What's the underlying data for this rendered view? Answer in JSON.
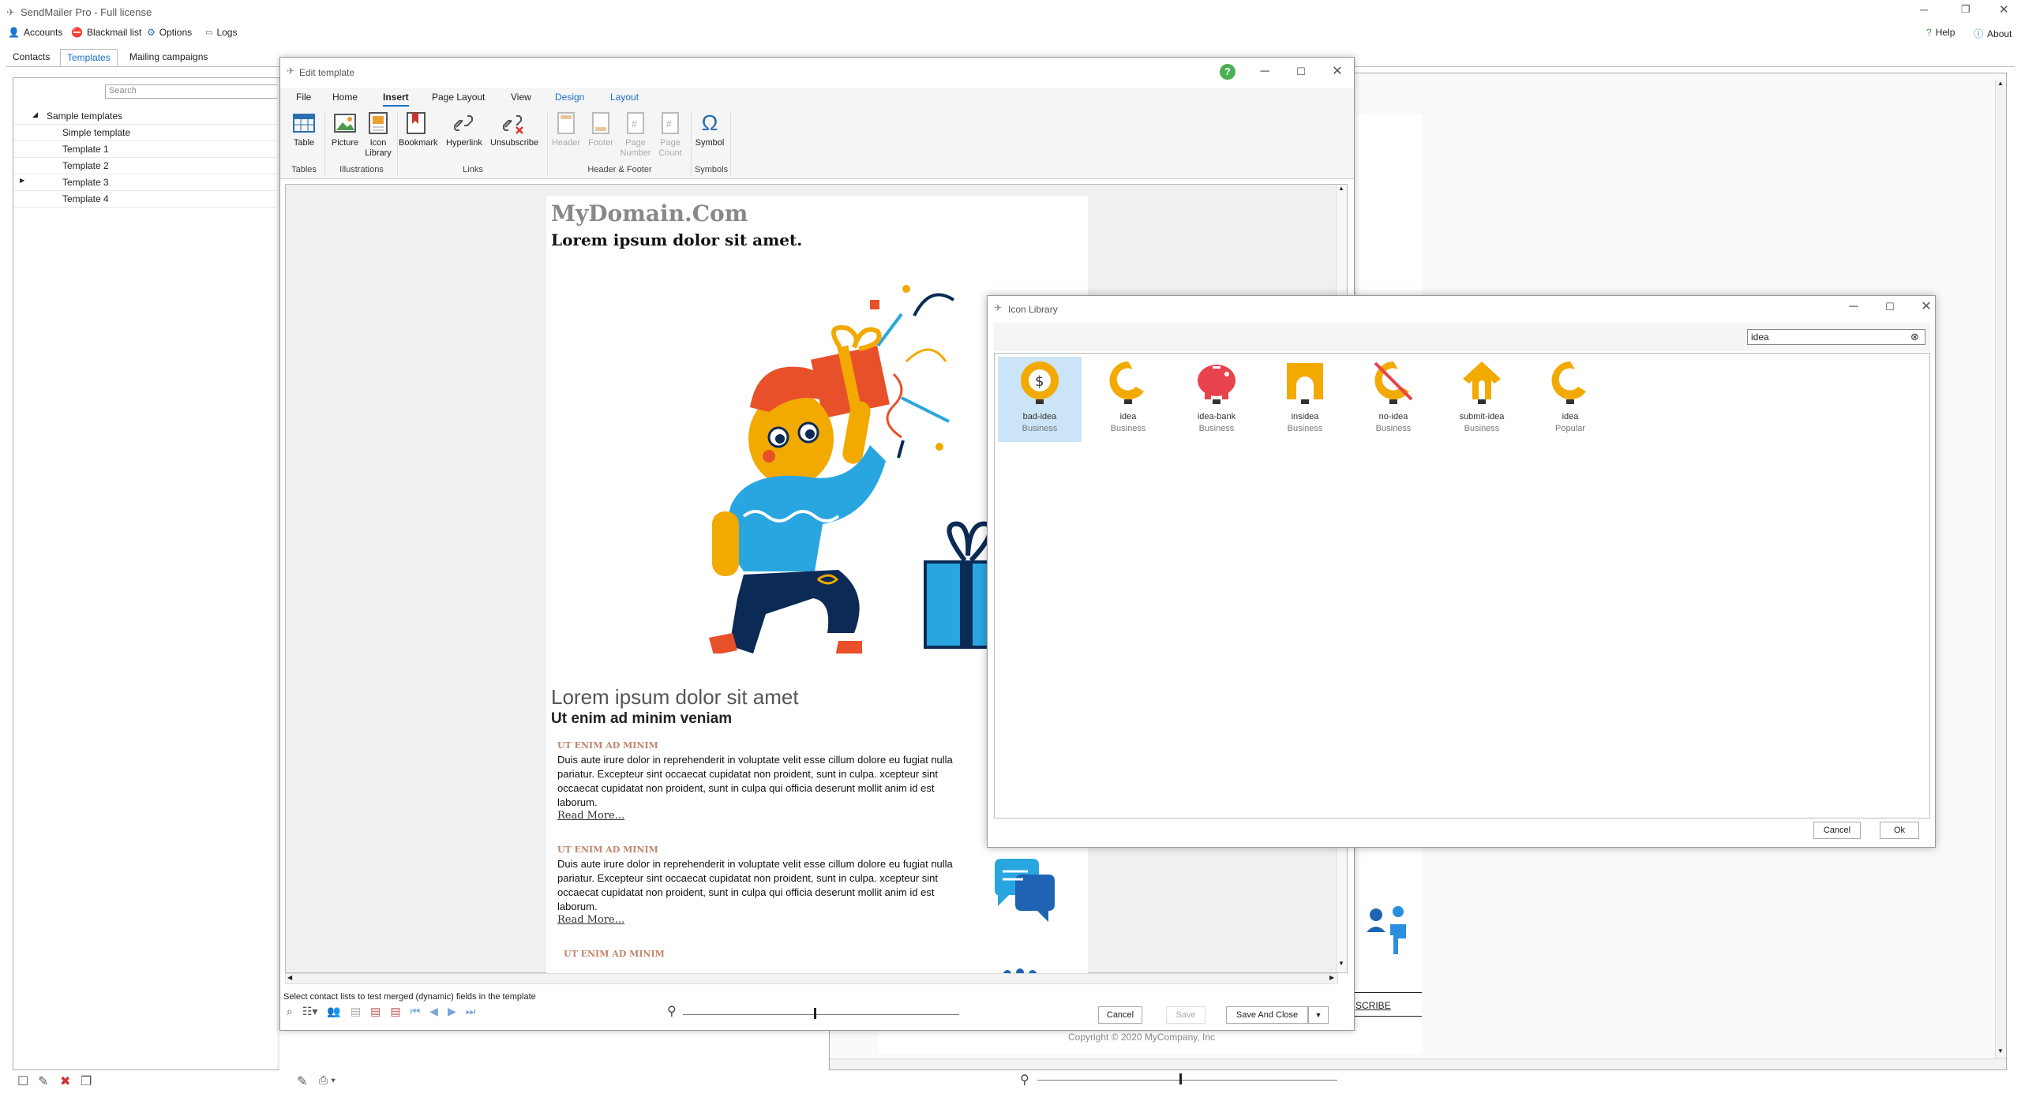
{
  "app": {
    "title": "SendMailer Pro - Full license",
    "menu": {
      "accounts": "Accounts",
      "blackmail": "Blackmail list",
      "options": "Options",
      "logs": "Logs",
      "help": "Help",
      "about": "About"
    },
    "tabs": [
      "Contacts",
      "Templates",
      "Mailing campaigns"
    ],
    "search_placeholder": "Search",
    "tree": {
      "root": "Sample templates",
      "items": [
        "Simple template",
        "Template 1",
        "Template 2",
        "Template 3",
        "Template 4"
      ]
    },
    "preview": {
      "unsubscribe_partial": "SCRIBE",
      "copyright": "Copyright © 2020 MyCompany, Inc"
    }
  },
  "edit_window": {
    "title": "Edit template",
    "ribbon_tabs": [
      "File",
      "Home",
      "Insert",
      "Page Layout",
      "View",
      "Design",
      "Layout"
    ],
    "active_tab": "Insert",
    "buttons": {
      "table": "Table",
      "picture": "Picture",
      "icon_library": "Icon Library",
      "bookmark": "Bookmark",
      "hyperlink": "Hyperlink",
      "unsubscribe": "Unsubscribe",
      "header": "Header",
      "footer": "Footer",
      "page_number": "Page Number",
      "page_count": "Page Count",
      "symbol": "Symbol"
    },
    "groups": {
      "tables": "Tables",
      "illustrations": "Illustrations",
      "links": "Links",
      "header_footer": "Header & Footer",
      "symbols": "Symbols"
    },
    "doc": {
      "domain": "MyDomain.Com",
      "heading": "Lorem ipsum dolor sit amet.",
      "h2": "Lorem ipsum dolor sit amet",
      "h3": "Ut enim ad minim veniam",
      "section_label": "UT ENIM AD MINIM",
      "body": "Duis aute irure dolor in reprehenderit in voluptate velit esse cillum dolore eu fugiat nulla pariatur. Excepteur sint occaecat cupidatat non proident, sunt in culpa. xcepteur sint occaecat cupidatat non proident, sunt in culpa qui officia deserunt mollit anim id est laborum.",
      "read_more": "Read More..."
    },
    "status": "Select contact lists to test merged (dynamic) fields in the template",
    "cancel": "Cancel",
    "save": "Save",
    "save_close": "Save And Close"
  },
  "icon_library": {
    "title": "Icon Library",
    "search_value": "idea",
    "icons": [
      {
        "name": "bad-idea",
        "category": "Business",
        "selected": true
      },
      {
        "name": "idea",
        "category": "Business",
        "selected": false
      },
      {
        "name": "idea-bank",
        "category": "Business",
        "selected": false
      },
      {
        "name": "insidea",
        "category": "Business",
        "selected": false
      },
      {
        "name": "no-idea",
        "category": "Business",
        "selected": false
      },
      {
        "name": "submit-idea",
        "category": "Business",
        "selected": false
      },
      {
        "name": "idea",
        "category": "Popular",
        "selected": false
      }
    ],
    "cancel": "Cancel",
    "ok": "Ok"
  },
  "colors": {
    "accent": "#1a6fc9",
    "icon_yellow": "#f2a900",
    "icon_red": "#e8434d",
    "selection": "#cce4f7",
    "section_label": "#c0856b"
  }
}
